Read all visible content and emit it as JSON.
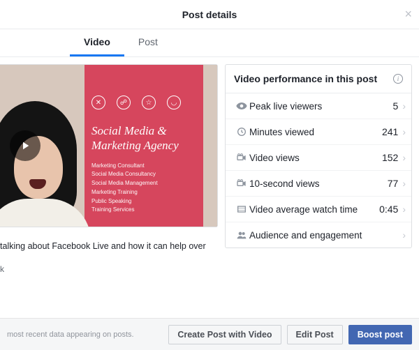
{
  "modal": {
    "title": "Post details"
  },
  "tabs": {
    "video": "Video",
    "post": "Post"
  },
  "banner": {
    "headline": "Social Media & Marketing Agency",
    "sub1": "Marketing Consultant",
    "sub2": "Social Media Consultancy",
    "sub3": "Social Media Management",
    "sub4": "Marketing Training",
    "sub5": "Public Speaking",
    "sub6": "Training Services"
  },
  "caption": {
    "text": "talking about Facebook Live and how it can help over",
    "linkSuffix": "k"
  },
  "panel": {
    "title": "Video performance in this post",
    "metrics": {
      "peak": {
        "label": "Peak live viewers",
        "value": "5"
      },
      "minutes": {
        "label": "Minutes viewed",
        "value": "241"
      },
      "views": {
        "label": "Video views",
        "value": "152"
      },
      "ten": {
        "label": "10-second views",
        "value": "77"
      },
      "avg": {
        "label": "Video average watch time",
        "value": "0:45"
      },
      "aud": {
        "label": "Audience and engagement",
        "value": ""
      }
    }
  },
  "footer": {
    "note": "most recent data appearing on posts.",
    "create": "Create Post with Video",
    "edit": "Edit Post",
    "boost": "Boost post"
  }
}
